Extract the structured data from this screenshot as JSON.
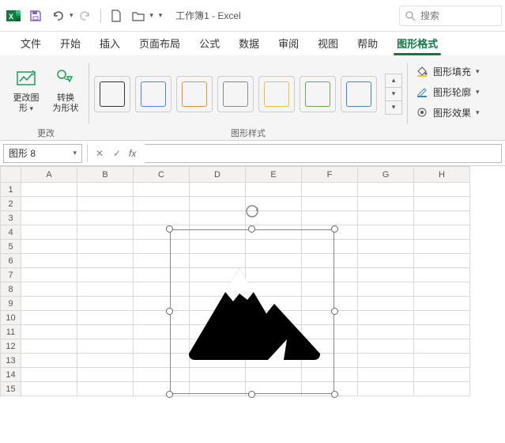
{
  "titlebar": {
    "doc_title": "工作簿1 - Excel",
    "search_placeholder": "搜索"
  },
  "tabs": {
    "file": "文件",
    "home": "开始",
    "insert": "插入",
    "layout": "页面布局",
    "formulas": "公式",
    "data": "数据",
    "review": "审阅",
    "view": "视图",
    "help": "帮助",
    "shape_format": "图形格式"
  },
  "ribbon": {
    "change_group_label": "更改",
    "change_graphic": "更改图\n形",
    "convert_to_shape": "转换\n为形状",
    "shape_styles_label": "图形样式",
    "shape_fill": "图形填充",
    "shape_outline": "图形轮廓",
    "shape_effects": "图形效果",
    "style_colors": [
      "#333333",
      "#4a86e8",
      "#e69138",
      "#888888",
      "#f1c232",
      "#6aa84f",
      "#3d85c6"
    ]
  },
  "formula": {
    "namebox": "图形 8"
  },
  "grid": {
    "columns": [
      "A",
      "B",
      "C",
      "D",
      "E",
      "F",
      "G",
      "H"
    ],
    "rows": [
      1,
      2,
      3,
      4,
      5,
      6,
      7,
      8,
      9,
      10,
      11,
      12,
      13,
      14,
      15
    ]
  }
}
